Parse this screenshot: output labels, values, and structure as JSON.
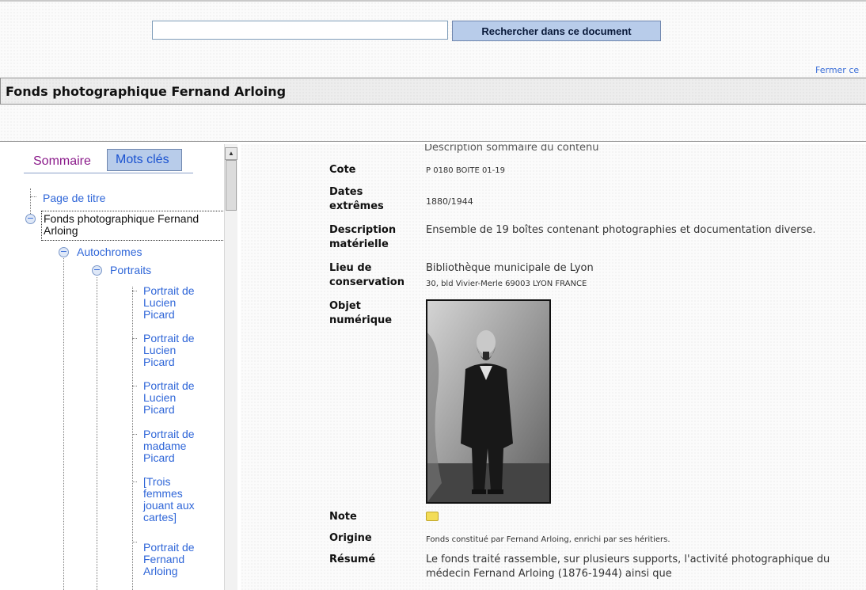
{
  "search": {
    "placeholder": "",
    "value": "",
    "button_label": "Rechercher dans ce document"
  },
  "header": {
    "close_link": "Fermer ce",
    "title": "Fonds photographique Fernand Arloing"
  },
  "sidebar": {
    "tabs": [
      {
        "label": "Sommaire"
      },
      {
        "label": "Mots clés"
      }
    ],
    "tree": {
      "title_page": "Page de titre",
      "fonds": "Fonds photographique Fernand Arloing",
      "autochromes": "Autochromes",
      "portraits": "Portraits",
      "items": [
        "Portrait de Lucien Picard",
        "Portrait de Lucien Picard",
        "Portrait de Lucien Picard",
        "Portrait de madame Picard",
        "[Trois femmes jouant aux cartes]",
        "Portrait de Fernand Arloing"
      ]
    }
  },
  "content": {
    "section_heading": "Description sommaire du contenu",
    "fields": {
      "cote": {
        "label": "Cote",
        "value": "P 0180 BOITE 01-19"
      },
      "dates": {
        "label": "Dates extrêmes",
        "value": "1880/1944"
      },
      "description": {
        "label": "Description matérielle",
        "value": "Ensemble de 19 boîtes contenant photographies et documentation diverse."
      },
      "lieu": {
        "label": "Lieu de conservation",
        "value": "Bibliothèque municipale de Lyon",
        "address": "30, bld Vivier-Merle 69003 LYON FRANCE"
      },
      "objet": {
        "label": "Objet numérique"
      },
      "note": {
        "label": "Note"
      },
      "origine": {
        "label": "Origine",
        "value": "Fonds constitué par Fernand Arloing, enrichi par ses héritiers."
      },
      "resume": {
        "label": "Résumé",
        "value": "Le fonds traité rassemble, sur plusieurs supports, l'activité photographique du médecin Fernand Arloing (1876-1944) ainsi que"
      }
    }
  },
  "colors": {
    "accent": "#b8ccea",
    "link": "#2f66d8",
    "tab_sommaire": "#8a1a8a"
  }
}
